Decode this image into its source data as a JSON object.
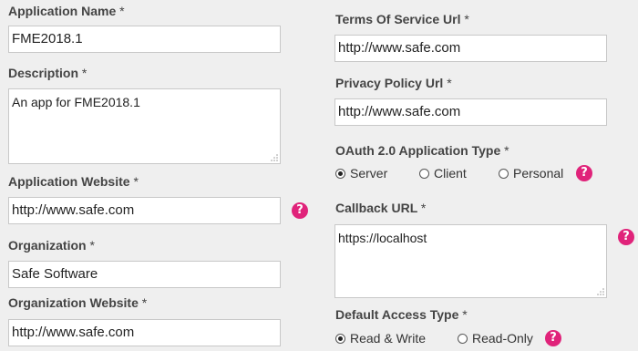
{
  "fields": {
    "application_name": {
      "label": "Application Name",
      "value": "FME2018.1"
    },
    "description": {
      "label": "Description",
      "value": "An app for FME2018.1"
    },
    "application_website": {
      "label": "Application Website",
      "value": "http://www.safe.com"
    },
    "organization": {
      "label": "Organization",
      "value": "Safe Software"
    },
    "organization_website": {
      "label": "Organization Website",
      "value": "http://www.safe.com"
    },
    "terms_of_service_url": {
      "label": "Terms Of Service Url",
      "value": "http://www.safe.com"
    },
    "privacy_policy_url": {
      "label": "Privacy Policy Url",
      "value": "http://www.safe.com"
    },
    "oauth_type": {
      "label": "OAuth 2.0 Application Type",
      "options": [
        "Server",
        "Client",
        "Personal"
      ],
      "selected": "Server"
    },
    "callback_url": {
      "label": "Callback URL",
      "value": "https://localhost"
    },
    "default_access_type": {
      "label": "Default Access Type",
      "options": [
        "Read & Write",
        "Read-Only"
      ],
      "selected": "Read & Write"
    }
  },
  "required_marker": "*",
  "help_glyph": "?",
  "colors": {
    "help_badge": "#e0237a",
    "background": "#efefef"
  },
  "icons": {
    "help": "help-icon",
    "resize": "resize-grip-icon"
  }
}
